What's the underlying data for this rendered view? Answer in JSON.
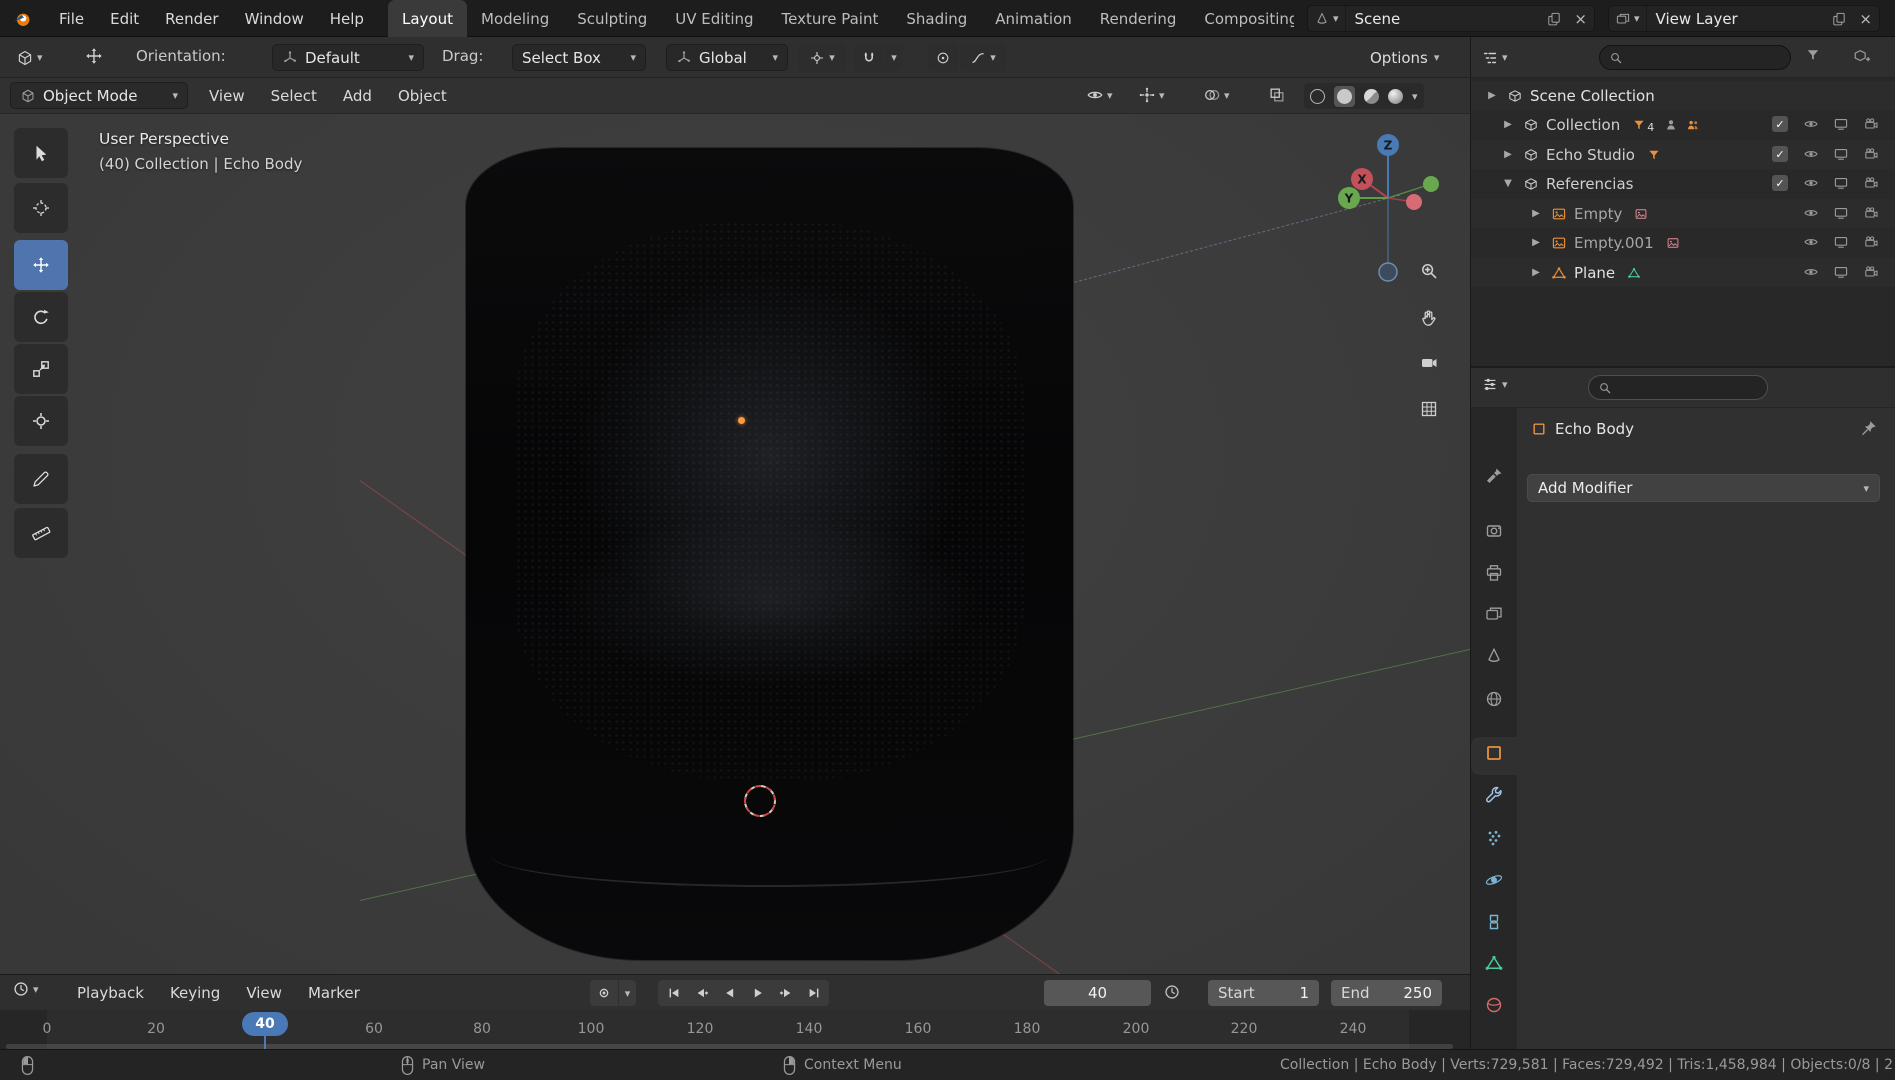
{
  "glyphs": {
    "chevron_down": "▾",
    "expander_closed": "▶",
    "expander_open": "▼",
    "close": "×",
    "check": "✓"
  },
  "topbar": {
    "menus": [
      "File",
      "Edit",
      "Render",
      "Window",
      "Help"
    ],
    "workspaces": [
      "Layout",
      "Modeling",
      "Sculpting",
      "UV Editing",
      "Texture Paint",
      "Shading",
      "Animation",
      "Rendering",
      "Compositing"
    ],
    "active_workspace": "Layout",
    "scene": {
      "value": "Scene"
    },
    "view_layer": {
      "value": "View Layer"
    }
  },
  "tool_settings": {
    "orientation_label": "Orientation:",
    "orientation_value": "Default",
    "drag_label": "Drag:",
    "drag_value": "Select Box",
    "transform_orientation": "Global",
    "options_label": "Options"
  },
  "viewport": {
    "mode": "Object Mode",
    "menus": [
      "View",
      "Select",
      "Add",
      "Object"
    ],
    "overlay": {
      "title": "User Perspective",
      "subtitle": "(40) Collection | Echo Body"
    },
    "gizmo": {
      "x": "X",
      "y": "Y",
      "z": "Z"
    }
  },
  "outliner": {
    "root_label": "Scene Collection",
    "rows": [
      {
        "name": "Scene Collection"
      },
      {
        "name": "Collection",
        "count": "4"
      },
      {
        "name": "Echo Studio"
      },
      {
        "name": "Referencias"
      },
      {
        "name": "Empty"
      },
      {
        "name": "Empty.001"
      },
      {
        "name": "Plane"
      }
    ]
  },
  "properties": {
    "active_object": "Echo Body",
    "add_modifier": "Add Modifier"
  },
  "timeline": {
    "menus": [
      "Playback",
      "Keying",
      "View",
      "Marker"
    ],
    "current_frame": "40",
    "playhead": "40",
    "start_label": "Start",
    "start_value": "1",
    "end_label": "End",
    "end_value": "250",
    "ticks": [
      "0",
      "20",
      "40",
      "60",
      "80",
      "100",
      "120",
      "140",
      "160",
      "180",
      "200",
      "220",
      "240"
    ]
  },
  "status": {
    "pan_view": "Pan View",
    "context_menu": "Context Menu",
    "stats": "Collection | Echo Body | Verts:729,581 | Faces:729,492 | Tris:1,458,984 | Objects:0/8 | 2"
  },
  "colors": {
    "accent": "#4772b3",
    "object_orange": "#e8913c",
    "mesh_green": "#46c290",
    "image_pink": "#e48a96",
    "axis_x": "#c4505a",
    "axis_y": "#6aa84f",
    "axis_z": "#4a7ab5"
  }
}
